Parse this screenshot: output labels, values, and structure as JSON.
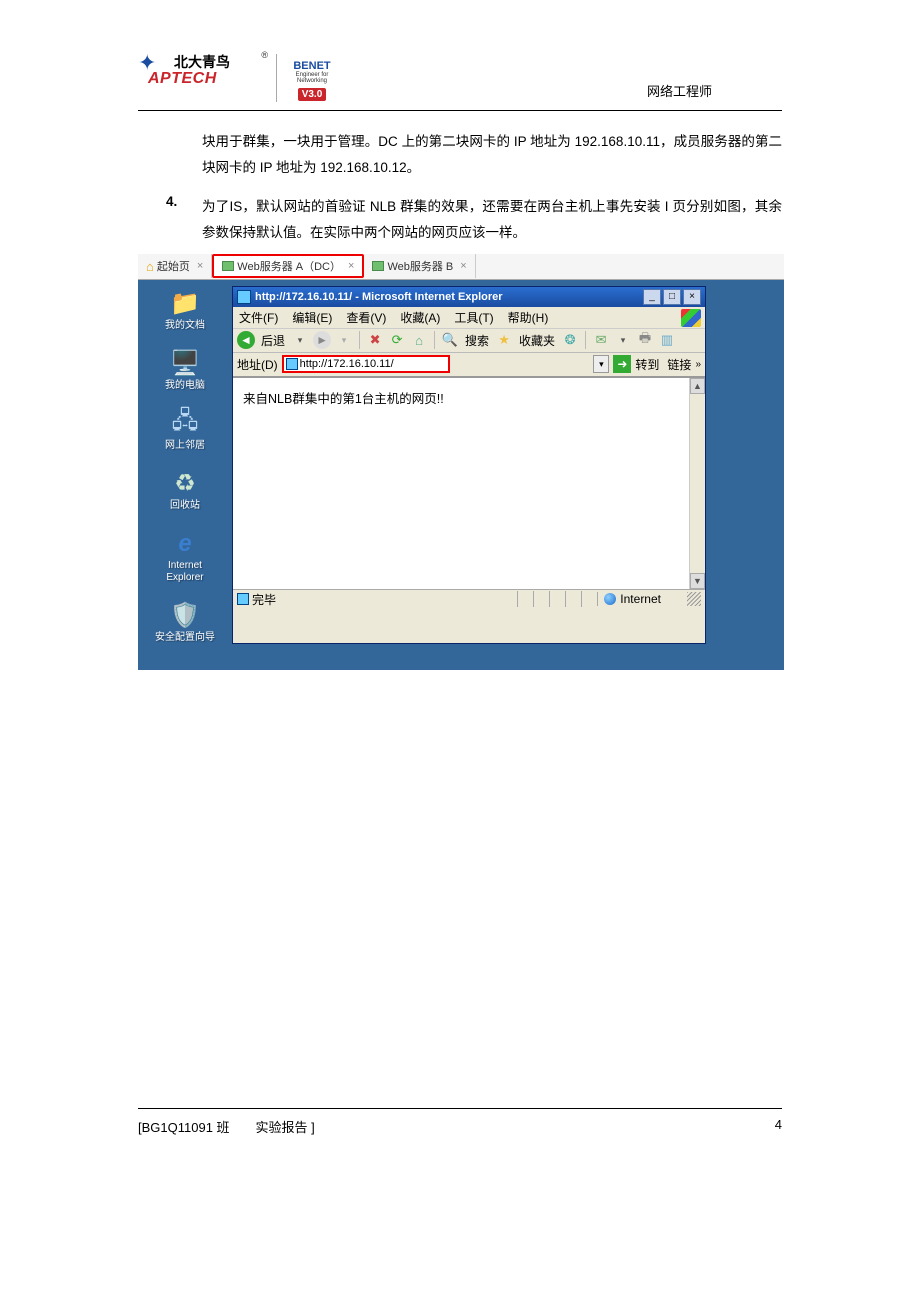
{
  "header": {
    "logo_cn": "北大青鸟",
    "logo_en": "APTECH",
    "reg": "®",
    "benet": "BENET",
    "benet_sub": "Engineer for Networking",
    "benet_ver": "V3.0",
    "right_text": "网络工程师"
  },
  "body": {
    "para1": "块用于群集，一块用于管理。DC 上的第二块网卡的 IP 地址为 192.168.10.11，成员服务器的第二块网卡的 IP 地址为 192.168.10.12。",
    "list_num": "4.",
    "para2": "为了IS，默认网站的首验证 NLB 群集的效果，还需要在两台主机上事先安装 I 页分别如图，其余参数保持默认值。在实际中两个网站的网页应该一样。"
  },
  "tabs": {
    "start": "起始页",
    "a": "Web服务器 A（DC）",
    "b": "Web服务器 B"
  },
  "desktop_icons": {
    "docs": "我的文档",
    "pc": "我的电脑",
    "net": "网上邻居",
    "recycle": "回收站",
    "ie": "Internet Explorer",
    "sec": "安全配置向导"
  },
  "ie": {
    "title": "http://172.16.10.11/ - Microsoft Internet Explorer",
    "menu": {
      "file": "文件(F)",
      "edit": "编辑(E)",
      "view": "查看(V)",
      "fav": "收藏(A)",
      "tools": "工具(T)",
      "help": "帮助(H)"
    },
    "toolbar": {
      "back": "后退",
      "search": "搜索",
      "favorites": "收藏夹"
    },
    "addr_label": "地址(D)",
    "url": "http://172.16.10.11/",
    "go": "转到",
    "links": "链接",
    "content": "来自NLB群集中的第1台主机的网页!!",
    "status_done": "完毕",
    "status_zone": "Internet"
  },
  "footer": {
    "left": "[BG1Q11091 班　　实验报告 ]",
    "right": "4"
  }
}
